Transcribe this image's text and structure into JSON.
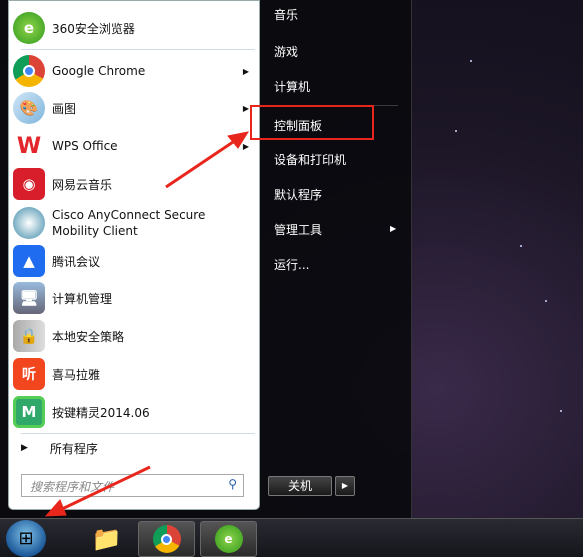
{
  "left_panel": {
    "pinned": [
      {
        "label": "360安全浏览器",
        "icon": "ie-360-icon"
      }
    ],
    "recent": [
      {
        "label": "Google Chrome",
        "icon": "chrome-icon",
        "submenu": true
      },
      {
        "label": "画图",
        "icon": "paint-icon",
        "submenu": true
      },
      {
        "label": "WPS Office",
        "icon": "wps-icon",
        "submenu": true
      },
      {
        "label": "网易云音乐",
        "icon": "netease-music-icon",
        "submenu": false
      },
      {
        "label": "Cisco AnyConnect Secure Mobility Client",
        "icon": "cisco-icon",
        "submenu": false
      },
      {
        "label": "腾讯会议",
        "icon": "tencent-meeting-icon",
        "submenu": false
      },
      {
        "label": "计算机管理",
        "icon": "computer-management-icon",
        "submenu": false
      },
      {
        "label": "本地安全策略",
        "icon": "security-policy-icon",
        "submenu": false
      },
      {
        "label": "喜马拉雅",
        "icon": "ximalaya-icon",
        "submenu": false
      },
      {
        "label": "按键精灵2014.06",
        "icon": "anjian-icon",
        "submenu": false
      }
    ],
    "all_programs": "所有程序",
    "search_placeholder": "搜索程序和文件"
  },
  "right_panel": {
    "items": [
      {
        "label": "音乐"
      },
      {
        "label": "游戏"
      },
      {
        "label": "计算机"
      },
      {
        "label": "控制面板",
        "highlighted": true
      },
      {
        "label": "设备和打印机"
      },
      {
        "label": "默认程序"
      },
      {
        "label": "管理工具",
        "submenu": true
      },
      {
        "label": "运行..."
      }
    ],
    "shutdown": "关机"
  },
  "taskbar": {
    "items": [
      {
        "icon": "file-explorer-icon"
      },
      {
        "icon": "chrome-icon"
      },
      {
        "icon": "ie-360-icon"
      }
    ]
  },
  "colors": {
    "annotation": "#e8261c"
  }
}
